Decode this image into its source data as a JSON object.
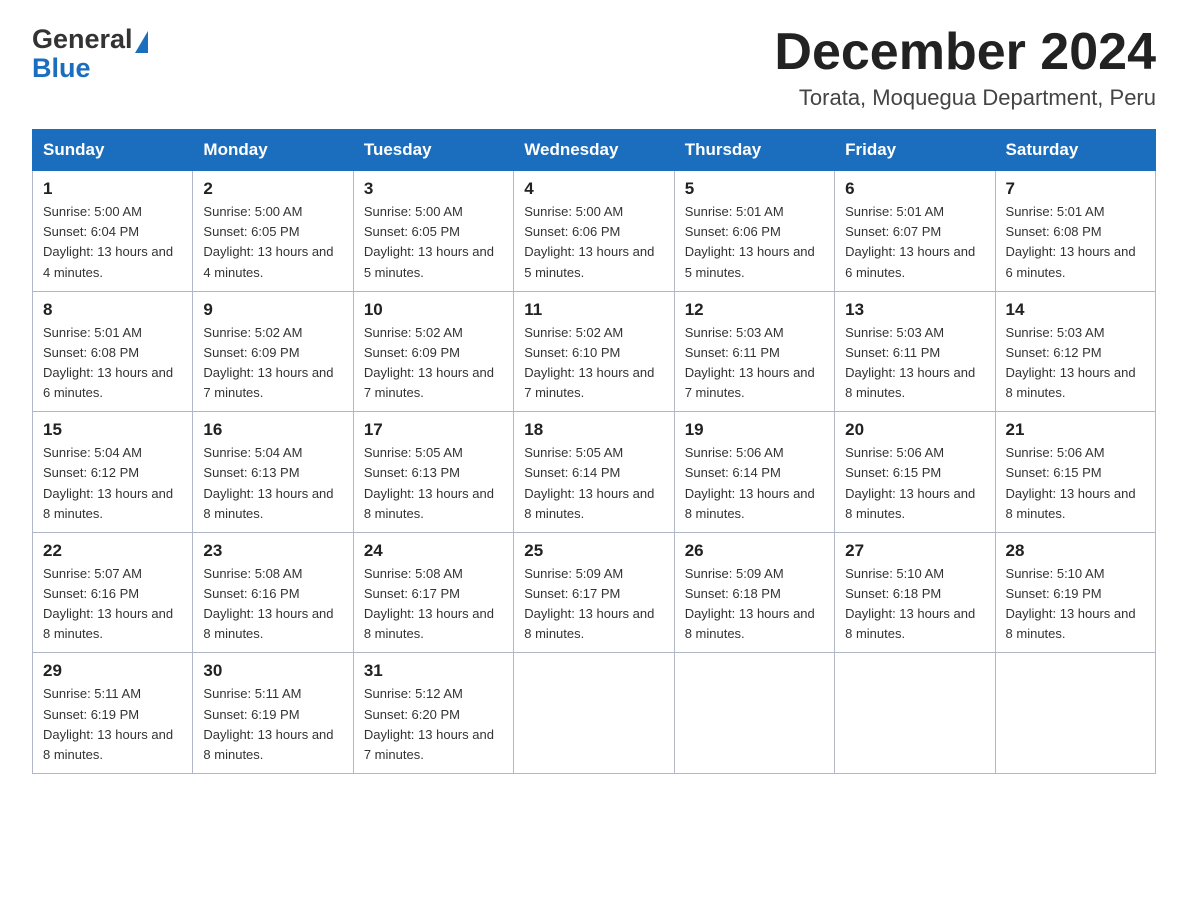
{
  "header": {
    "logo_general": "General",
    "logo_blue": "Blue",
    "month_title": "December 2024",
    "location": "Torata, Moquegua Department, Peru"
  },
  "weekdays": [
    "Sunday",
    "Monday",
    "Tuesday",
    "Wednesday",
    "Thursday",
    "Friday",
    "Saturday"
  ],
  "weeks": [
    [
      {
        "day": "1",
        "sunrise": "5:00 AM",
        "sunset": "6:04 PM",
        "daylight": "13 hours and 4 minutes."
      },
      {
        "day": "2",
        "sunrise": "5:00 AM",
        "sunset": "6:05 PM",
        "daylight": "13 hours and 4 minutes."
      },
      {
        "day": "3",
        "sunrise": "5:00 AM",
        "sunset": "6:05 PM",
        "daylight": "13 hours and 5 minutes."
      },
      {
        "day": "4",
        "sunrise": "5:00 AM",
        "sunset": "6:06 PM",
        "daylight": "13 hours and 5 minutes."
      },
      {
        "day": "5",
        "sunrise": "5:01 AM",
        "sunset": "6:06 PM",
        "daylight": "13 hours and 5 minutes."
      },
      {
        "day": "6",
        "sunrise": "5:01 AM",
        "sunset": "6:07 PM",
        "daylight": "13 hours and 6 minutes."
      },
      {
        "day": "7",
        "sunrise": "5:01 AM",
        "sunset": "6:08 PM",
        "daylight": "13 hours and 6 minutes."
      }
    ],
    [
      {
        "day": "8",
        "sunrise": "5:01 AM",
        "sunset": "6:08 PM",
        "daylight": "13 hours and 6 minutes."
      },
      {
        "day": "9",
        "sunrise": "5:02 AM",
        "sunset": "6:09 PM",
        "daylight": "13 hours and 7 minutes."
      },
      {
        "day": "10",
        "sunrise": "5:02 AM",
        "sunset": "6:09 PM",
        "daylight": "13 hours and 7 minutes."
      },
      {
        "day": "11",
        "sunrise": "5:02 AM",
        "sunset": "6:10 PM",
        "daylight": "13 hours and 7 minutes."
      },
      {
        "day": "12",
        "sunrise": "5:03 AM",
        "sunset": "6:11 PM",
        "daylight": "13 hours and 7 minutes."
      },
      {
        "day": "13",
        "sunrise": "5:03 AM",
        "sunset": "6:11 PM",
        "daylight": "13 hours and 8 minutes."
      },
      {
        "day": "14",
        "sunrise": "5:03 AM",
        "sunset": "6:12 PM",
        "daylight": "13 hours and 8 minutes."
      }
    ],
    [
      {
        "day": "15",
        "sunrise": "5:04 AM",
        "sunset": "6:12 PM",
        "daylight": "13 hours and 8 minutes."
      },
      {
        "day": "16",
        "sunrise": "5:04 AM",
        "sunset": "6:13 PM",
        "daylight": "13 hours and 8 minutes."
      },
      {
        "day": "17",
        "sunrise": "5:05 AM",
        "sunset": "6:13 PM",
        "daylight": "13 hours and 8 minutes."
      },
      {
        "day": "18",
        "sunrise": "5:05 AM",
        "sunset": "6:14 PM",
        "daylight": "13 hours and 8 minutes."
      },
      {
        "day": "19",
        "sunrise": "5:06 AM",
        "sunset": "6:14 PM",
        "daylight": "13 hours and 8 minutes."
      },
      {
        "day": "20",
        "sunrise": "5:06 AM",
        "sunset": "6:15 PM",
        "daylight": "13 hours and 8 minutes."
      },
      {
        "day": "21",
        "sunrise": "5:06 AM",
        "sunset": "6:15 PM",
        "daylight": "13 hours and 8 minutes."
      }
    ],
    [
      {
        "day": "22",
        "sunrise": "5:07 AM",
        "sunset": "6:16 PM",
        "daylight": "13 hours and 8 minutes."
      },
      {
        "day": "23",
        "sunrise": "5:08 AM",
        "sunset": "6:16 PM",
        "daylight": "13 hours and 8 minutes."
      },
      {
        "day": "24",
        "sunrise": "5:08 AM",
        "sunset": "6:17 PM",
        "daylight": "13 hours and 8 minutes."
      },
      {
        "day": "25",
        "sunrise": "5:09 AM",
        "sunset": "6:17 PM",
        "daylight": "13 hours and 8 minutes."
      },
      {
        "day": "26",
        "sunrise": "5:09 AM",
        "sunset": "6:18 PM",
        "daylight": "13 hours and 8 minutes."
      },
      {
        "day": "27",
        "sunrise": "5:10 AM",
        "sunset": "6:18 PM",
        "daylight": "13 hours and 8 minutes."
      },
      {
        "day": "28",
        "sunrise": "5:10 AM",
        "sunset": "6:19 PM",
        "daylight": "13 hours and 8 minutes."
      }
    ],
    [
      {
        "day": "29",
        "sunrise": "5:11 AM",
        "sunset": "6:19 PM",
        "daylight": "13 hours and 8 minutes."
      },
      {
        "day": "30",
        "sunrise": "5:11 AM",
        "sunset": "6:19 PM",
        "daylight": "13 hours and 8 minutes."
      },
      {
        "day": "31",
        "sunrise": "5:12 AM",
        "sunset": "6:20 PM",
        "daylight": "13 hours and 7 minutes."
      },
      null,
      null,
      null,
      null
    ]
  ]
}
